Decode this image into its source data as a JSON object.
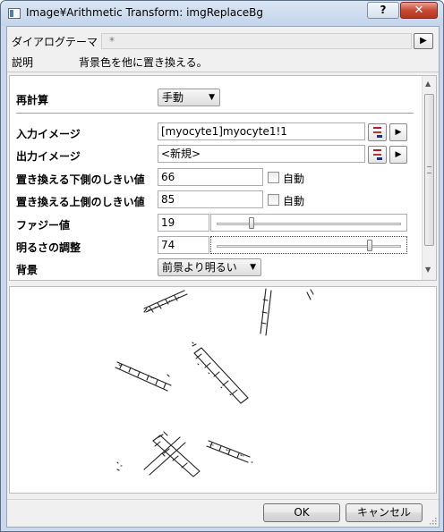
{
  "window": {
    "title": "Image¥Arithmetic Transform: imgReplaceBg",
    "help_label": "?",
    "close_label": "✕"
  },
  "theme": {
    "label": "ダイアログテーマ",
    "value": "*",
    "arrow": "▶"
  },
  "description": {
    "label": "説明",
    "text": "背景色を他に置き換える。"
  },
  "fields": {
    "recalc": {
      "label": "再計算",
      "value": "手動",
      "arrow": "▼"
    },
    "input_image": {
      "label": "入力イメージ",
      "value": "[myocyte1]myocyte1!1",
      "play": "▶"
    },
    "output_image": {
      "label": "出力イメージ",
      "value": "<新規>",
      "play": "▶"
    },
    "lower_threshold": {
      "label": "置き換える下側のしきい値",
      "value": "66",
      "auto_label": "自動",
      "auto_checked": false
    },
    "upper_threshold": {
      "label": "置き換える上側のしきい値",
      "value": "85",
      "auto_label": "自動",
      "auto_checked": false
    },
    "fuzzy": {
      "label": "ファジー値",
      "value": "19",
      "slider_fraction": 0.19
    },
    "brightness": {
      "label": "明るさの調整",
      "value": "74",
      "slider_fraction": 0.83
    },
    "background": {
      "label": "背景",
      "value": "前景より明るい",
      "arrow": "▼"
    }
  },
  "scrollbar": {
    "up": "▲",
    "down": "▼"
  },
  "buttons": {
    "ok": "OK",
    "cancel": "キャンセル"
  },
  "colors": {
    "close_red": "#c74a33",
    "title_bg": "#c9d8ea",
    "preview_ink": "#222222"
  }
}
